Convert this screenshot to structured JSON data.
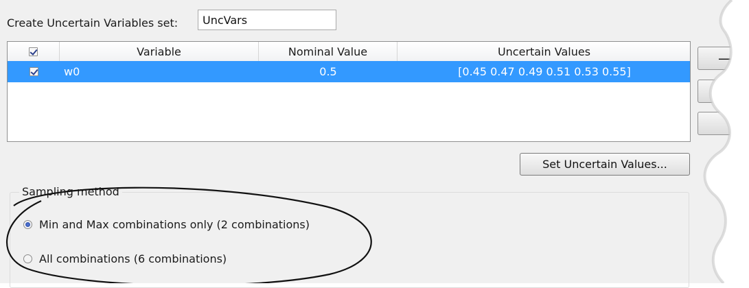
{
  "name_label": "Create Uncertain Variables set:",
  "name_value": "UncVars",
  "table": {
    "headers": [
      "Variable",
      "Nominal Value",
      "Uncertain Values"
    ],
    "rows": [
      {
        "checked": true,
        "variable": "w0",
        "nominal": "0.5",
        "uncertain": "[0.45 0.47 0.49 0.51 0.53 0.55]"
      }
    ]
  },
  "side_buttons": {
    "remove_label": "—"
  },
  "set_button_label": "Set Uncertain Values...",
  "sampling": {
    "title": "Sampling method",
    "options": [
      {
        "label": "Min and Max combinations only (2 combinations)",
        "selected": true
      },
      {
        "label": "All combinations (6 combinations)",
        "selected": false
      }
    ]
  },
  "colors": {
    "selection": "#3399ff",
    "panel": "#f0f0f0"
  }
}
